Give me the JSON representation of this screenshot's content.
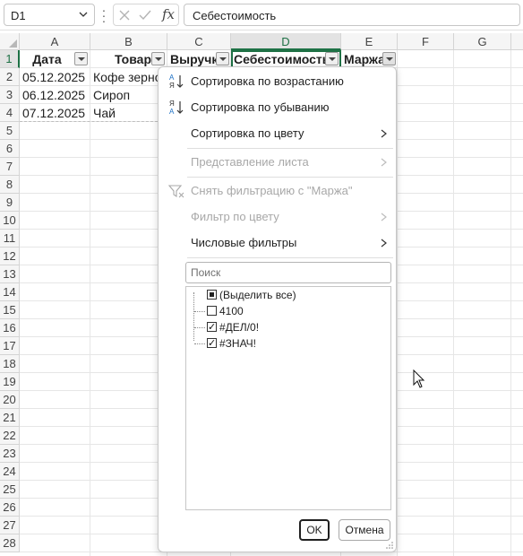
{
  "formula_bar": {
    "name_box": "D1",
    "fx_label": "fx",
    "formula": "Себестоимость"
  },
  "columns": [
    "A",
    "B",
    "C",
    "D",
    "E",
    "F",
    "G"
  ],
  "rows": [
    "1",
    "2",
    "3",
    "4",
    "5",
    "6",
    "7",
    "8",
    "9",
    "10",
    "11",
    "12",
    "13",
    "14",
    "15",
    "16",
    "17",
    "18",
    "19",
    "20",
    "21",
    "22",
    "23",
    "24",
    "25",
    "26",
    "27",
    "28"
  ],
  "table": {
    "headers": [
      "Дата",
      "Товар",
      "Выручка",
      "Себестоимость",
      "Маржа"
    ],
    "data": [
      [
        "05.12.2025",
        "Кофе зерно"
      ],
      [
        "06.12.2025",
        "Сироп"
      ],
      [
        "07.12.2025",
        "Чай"
      ]
    ]
  },
  "filter_menu": {
    "sort_asc": "Сортировка по возрастанию",
    "sort_desc": "Сортировка по убыванию",
    "sort_color": "Сортировка по цвету",
    "sheet_view": "Представление листа",
    "clear_filter": "Снять фильтрацию с \"Маржа\"",
    "filter_color": "Фильтр по цвету",
    "number_filters": "Числовые фильтры",
    "search_placeholder": "Поиск",
    "items": [
      {
        "label": "(Выделить все)",
        "state": "partial"
      },
      {
        "label": "4100",
        "state": "unchecked"
      },
      {
        "label": "#ДЕЛ/0!",
        "state": "checked"
      },
      {
        "label": "#ЗНАЧ!",
        "state": "checked"
      }
    ],
    "ok": "OK",
    "cancel": "Отмена"
  }
}
